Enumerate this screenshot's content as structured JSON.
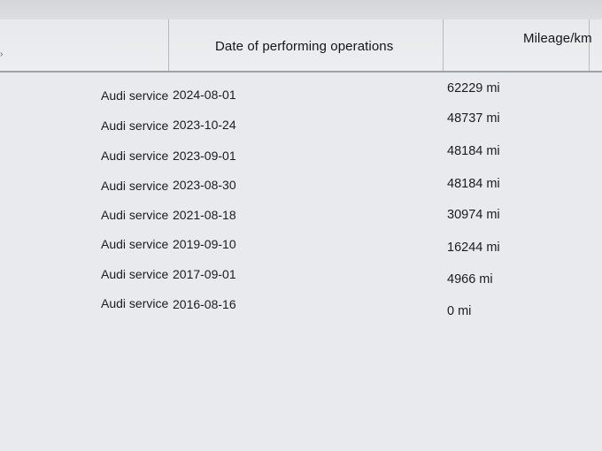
{
  "table": {
    "headers": {
      "date": "Date of performing operations",
      "mileage": "Mileage/km"
    },
    "rows": [
      {
        "type": "Audi service",
        "date": "2024-08-01",
        "mileage": "62229 mi"
      },
      {
        "type": "Audi service",
        "date": "2023-10-24",
        "mileage": "48737 mi"
      },
      {
        "type": "Audi service",
        "date": "2023-09-01",
        "mileage": "48184 mi"
      },
      {
        "type": "Audi service",
        "date": "2023-08-30",
        "mileage": "48184 mi"
      },
      {
        "type": "Audi service",
        "date": "2021-08-18",
        "mileage": "30974 mi"
      },
      {
        "type": "Audi service",
        "date": "2019-09-10",
        "mileage": "16244 mi"
      },
      {
        "type": "Audi service",
        "date": "2017-09-01",
        "mileage": "4966 mi"
      },
      {
        "type": "Audi service",
        "date": "2016-08-16",
        "mileage": "0 mi"
      }
    ]
  }
}
